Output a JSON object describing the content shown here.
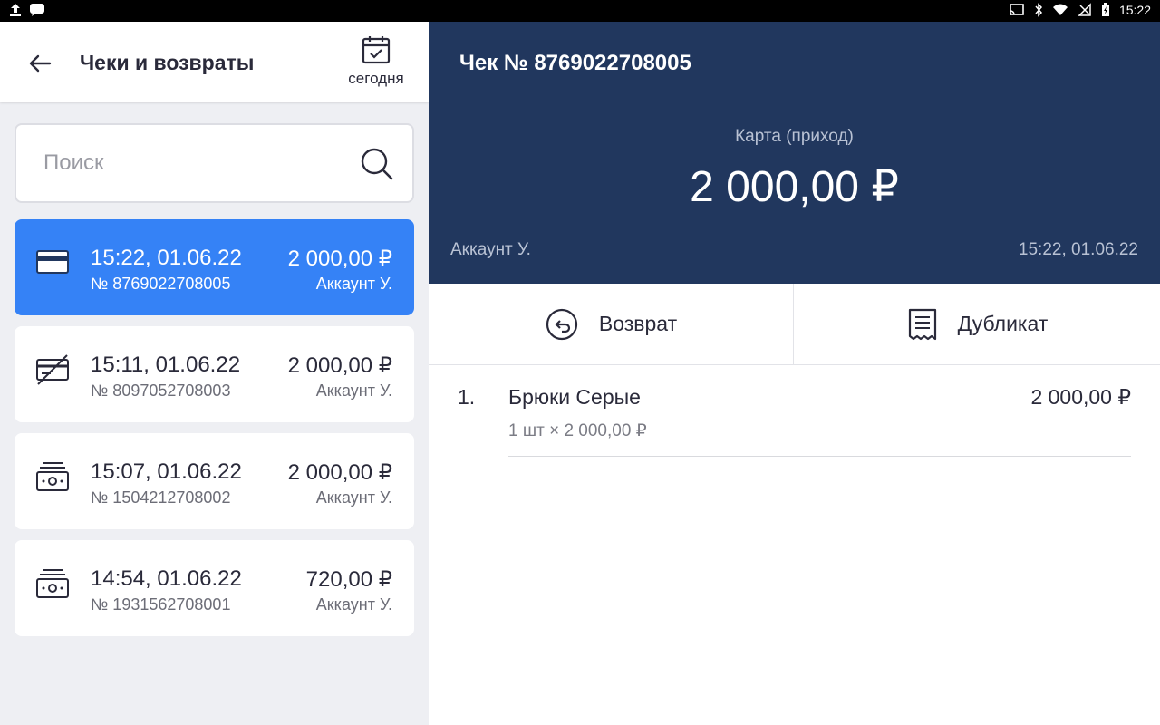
{
  "status_bar": {
    "time": "15:22"
  },
  "header": {
    "title": "Чеки и возвраты",
    "today_label": "сегодня"
  },
  "search": {
    "placeholder": "Поиск",
    "value": ""
  },
  "receipts": [
    {
      "time": "15:22, 01.06.22",
      "number": "№ 8769022708005",
      "amount": "2 000,00 ₽",
      "account": "Аккаунт У.",
      "icon": "card-icon",
      "selected": true
    },
    {
      "time": "15:11, 01.06.22",
      "number": "№ 8097052708003",
      "amount": "2 000,00 ₽",
      "account": "Аккаунт У.",
      "icon": "card-refund-icon",
      "selected": false
    },
    {
      "time": "15:07, 01.06.22",
      "number": "№ 1504212708002",
      "amount": "2 000,00 ₽",
      "account": "Аккаунт У.",
      "icon": "cash-icon",
      "selected": false
    },
    {
      "time": "14:54, 01.06.22",
      "number": "№ 1931562708001",
      "amount": "720,00 ₽",
      "account": "Аккаунт У.",
      "icon": "cash-icon",
      "selected": false
    }
  ],
  "detail": {
    "title": "Чек № 8769022708005",
    "payment_type": "Карта (приход)",
    "amount": "2 000,00 ₽",
    "account": "Аккаунт У.",
    "datetime": "15:22, 01.06.22"
  },
  "actions": {
    "refund_label": "Возврат",
    "duplicate_label": "Дубликат"
  },
  "items": [
    {
      "index": "1.",
      "name": "Брюки Серые",
      "price": "2 000,00 ₽",
      "quantity": "1 шт × 2 000,00 ₽"
    }
  ],
  "colors": {
    "accent": "#3582f6",
    "header_bg": "#21375e",
    "list_bg": "#eeeff3"
  }
}
